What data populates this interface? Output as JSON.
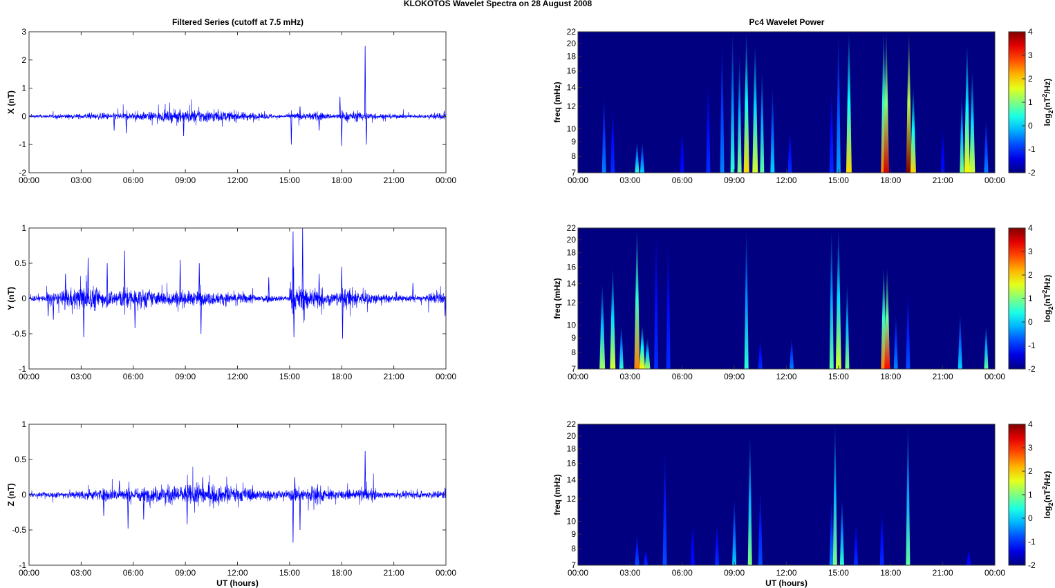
{
  "figure_title": "KLOKOTOS Wavelet Spectra on 28 August    2008",
  "chart_data": [
    {
      "type": "line",
      "title": "Filtered Series (cutoff at 7.5 mHz)",
      "panels": [
        {
          "name": "X",
          "ylabel": "X (nT)",
          "ylim": [
            -2,
            3
          ],
          "yticks": [
            "3",
            "2",
            "1",
            "0",
            "-1",
            "-2"
          ],
          "ytick_values": [
            3,
            2,
            1,
            0,
            -1,
            -2
          ],
          "noise_amplitude_by_hour": [
            0.04,
            0.05,
            0.06,
            0.07,
            0.08,
            0.09,
            0.1,
            0.12,
            0.14,
            0.16,
            0.15,
            0.12,
            0.1,
            0.07,
            0.04,
            0.08,
            0.1,
            0.07,
            0.12,
            0.1,
            0.06,
            0.05,
            0.04,
            0.08
          ],
          "spikes": [
            [
              4.9,
              -0.5
            ],
            [
              5.6,
              -0.6
            ],
            [
              8.9,
              -0.7
            ],
            [
              15.1,
              -1.0
            ],
            [
              15.6,
              0.35
            ],
            [
              16.7,
              -0.5
            ],
            [
              17.9,
              0.7
            ],
            [
              18.0,
              -1.05
            ],
            [
              19.35,
              2.5
            ],
            [
              19.42,
              -1.0
            ],
            [
              23.9,
              0.2
            ]
          ]
        },
        {
          "name": "Y",
          "ylabel": "Y (nT)",
          "ylim": [
            -1,
            1
          ],
          "yticks": [
            "1",
            "0.5",
            "0",
            "-0.5",
            "-1"
          ],
          "ytick_values": [
            1,
            0.5,
            0,
            -0.5,
            -1
          ],
          "noise_amplitude_by_hour": [
            0.03,
            0.06,
            0.1,
            0.12,
            0.08,
            0.1,
            0.09,
            0.07,
            0.08,
            0.07,
            0.06,
            0.06,
            0.05,
            0.04,
            0.03,
            0.12,
            0.1,
            0.06,
            0.1,
            0.06,
            0.04,
            0.03,
            0.03,
            0.05
          ],
          "spikes": [
            [
              1.1,
              -0.25
            ],
            [
              1.4,
              -0.3
            ],
            [
              2.1,
              0.35
            ],
            [
              3.15,
              -0.55
            ],
            [
              3.4,
              0.58
            ],
            [
              4.5,
              0.5
            ],
            [
              5.5,
              0.68
            ],
            [
              6.1,
              -0.42
            ],
            [
              8.7,
              0.55
            ],
            [
              9.8,
              0.5
            ],
            [
              9.9,
              -0.5
            ],
            [
              13.8,
              0.3
            ],
            [
              15.2,
              0.95
            ],
            [
              15.25,
              -0.55
            ],
            [
              15.75,
              1.0
            ],
            [
              16.7,
              0.35
            ],
            [
              18.0,
              0.45
            ],
            [
              18.05,
              -0.57
            ],
            [
              22.1,
              0.22
            ],
            [
              23.95,
              -0.25
            ]
          ]
        },
        {
          "name": "Z",
          "ylabel": "Z (nT)",
          "ylim": [
            -1,
            1
          ],
          "yticks": [
            "1",
            "0.5",
            "0",
            "-0.5",
            "-1"
          ],
          "ytick_values": [
            1,
            0.5,
            0,
            -0.5,
            -1
          ],
          "noise_amplitude_by_hour": [
            0.02,
            0.03,
            0.04,
            0.05,
            0.06,
            0.06,
            0.07,
            0.08,
            0.09,
            0.1,
            0.09,
            0.08,
            0.07,
            0.05,
            0.04,
            0.07,
            0.08,
            0.05,
            0.04,
            0.06,
            0.03,
            0.03,
            0.03,
            0.04
          ],
          "spikes": [
            [
              4.3,
              -0.3
            ],
            [
              5.2,
              0.2
            ],
            [
              5.7,
              -0.48
            ],
            [
              6.6,
              -0.35
            ],
            [
              9.1,
              -0.42
            ],
            [
              10.0,
              0.25
            ],
            [
              15.2,
              -0.68
            ],
            [
              15.6,
              -0.5
            ],
            [
              15.3,
              0.25
            ],
            [
              19.35,
              0.62
            ],
            [
              23.95,
              0.1
            ]
          ]
        }
      ],
      "xlabel": "UT (hours)",
      "xticks": [
        "00:00",
        "03:00",
        "06:00",
        "09:00",
        "12:00",
        "15:00",
        "18:00",
        "21:00",
        "00:00"
      ],
      "xlim": [
        0,
        24
      ],
      "line_color": "#0000ff"
    },
    {
      "type": "heatmap",
      "title": "Pc4 Wavelet Power",
      "ylabel": "freq (mHz)",
      "ylim": [
        7,
        22
      ],
      "yscale": "log",
      "yticks": [
        "22",
        "20",
        "18",
        "16",
        "14",
        "12",
        "10",
        "9",
        "8",
        "7"
      ],
      "ytick_values": [
        22,
        20,
        18,
        16,
        14,
        12,
        10,
        9,
        8,
        7
      ],
      "xticks": [
        "00:00",
        "03:00",
        "06:00",
        "09:00",
        "12:00",
        "15:00",
        "18:00",
        "21:00",
        "00:00"
      ],
      "xlim": [
        0,
        24
      ],
      "xlabel": "UT (hours)",
      "colorbar": {
        "label": "log2(nT2/Hz)",
        "label_base": "log",
        "label_sub": "2",
        "label_mid": "(nT",
        "label_sup": "2",
        "label_end": "/Hz)",
        "range": [
          -2,
          4
        ],
        "ticks": [
          "4",
          "3",
          "2",
          "1",
          "0",
          "-1",
          "-2"
        ],
        "tick_values": [
          4,
          3,
          2,
          1,
          0,
          -1,
          -2
        ],
        "colormap": "jet"
      },
      "background_power": -2,
      "panels": [
        {
          "name": "X",
          "bursts": [
            [
              1.5,
              -0.5,
              13
            ],
            [
              2.0,
              -1,
              12
            ],
            [
              3.4,
              0.5,
              9
            ],
            [
              3.7,
              0,
              9
            ],
            [
              6.0,
              -1.2,
              10
            ],
            [
              7.5,
              -1,
              15
            ],
            [
              8.3,
              -0.5,
              20
            ],
            [
              8.9,
              0.5,
              22
            ],
            [
              9.3,
              1,
              18
            ],
            [
              9.7,
              2,
              22
            ],
            [
              10.2,
              1.5,
              20
            ],
            [
              10.6,
              0.8,
              16
            ],
            [
              11.2,
              0,
              14
            ],
            [
              12.2,
              -1,
              10
            ],
            [
              14.6,
              -1,
              14
            ],
            [
              15.0,
              -0.3,
              22
            ],
            [
              15.6,
              2,
              22
            ],
            [
              17.6,
              2.5,
              22
            ],
            [
              17.75,
              3.5,
              22
            ],
            [
              19.05,
              4,
              22
            ],
            [
              19.3,
              2,
              14
            ],
            [
              21.0,
              -1.2,
              10
            ],
            [
              22.1,
              1,
              13
            ],
            [
              22.4,
              1.8,
              20
            ],
            [
              22.7,
              1.5,
              16
            ],
            [
              23.5,
              -0.5,
              11
            ]
          ]
        },
        {
          "name": "Y",
          "bursts": [
            [
              1.4,
              1.2,
              14
            ],
            [
              2.0,
              1.5,
              16
            ],
            [
              2.5,
              0.5,
              10
            ],
            [
              3.4,
              2.5,
              22
            ],
            [
              3.7,
              1.8,
              10
            ],
            [
              4.0,
              1.2,
              9
            ],
            [
              4.5,
              -1,
              22
            ],
            [
              5.2,
              -1,
              20
            ],
            [
              9.7,
              0.5,
              22
            ],
            [
              10.5,
              -1,
              9
            ],
            [
              12.3,
              -0.5,
              9
            ],
            [
              14.6,
              0.8,
              22
            ],
            [
              15.0,
              1.5,
              22
            ],
            [
              15.5,
              1,
              14
            ],
            [
              17.6,
              2.5,
              16
            ],
            [
              17.8,
              3.2,
              16
            ],
            [
              18.3,
              -0.5,
              11
            ],
            [
              19.0,
              -0.8,
              13
            ],
            [
              22.0,
              0,
              11
            ],
            [
              23.5,
              0.8,
              10
            ]
          ]
        },
        {
          "name": "Z",
          "bursts": [
            [
              3.4,
              -0.8,
              9
            ],
            [
              3.9,
              -1,
              8
            ],
            [
              5.0,
              -0.8,
              18
            ],
            [
              6.6,
              -1.2,
              10
            ],
            [
              8.0,
              -1,
              10
            ],
            [
              9.0,
              0,
              12
            ],
            [
              9.9,
              1,
              20
            ],
            [
              10.5,
              -0.8,
              13
            ],
            [
              14.6,
              -0.5,
              12
            ],
            [
              14.8,
              1,
              22
            ],
            [
              15.2,
              0.5,
              12
            ],
            [
              16.0,
              -1,
              10
            ],
            [
              17.5,
              -1,
              11
            ],
            [
              19.0,
              0.8,
              22
            ],
            [
              22.5,
              -1.2,
              8
            ]
          ]
        }
      ]
    }
  ]
}
